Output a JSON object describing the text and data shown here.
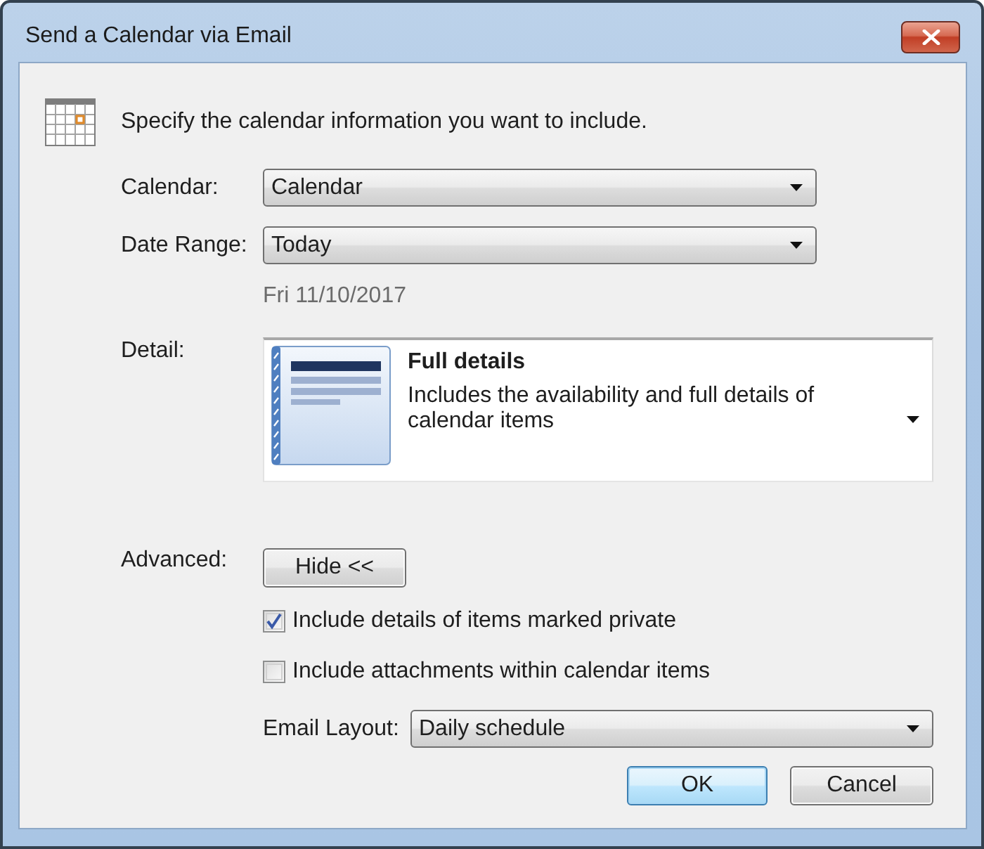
{
  "window": {
    "title": "Send a Calendar via Email"
  },
  "instruction": "Specify the calendar information you want to include.",
  "fields": [
    {
      "label": "Calendar:",
      "value": "Calendar"
    },
    {
      "label": "Date Range:",
      "value": "Today",
      "note": "Fri 11/10/2017"
    }
  ],
  "detail": {
    "label": "Detail:",
    "title": "Full details",
    "description": "Includes the availability and full details of calendar items"
  },
  "advanced": {
    "label": "Advanced:",
    "toggle_button": "Hide <<",
    "options": [
      {
        "label": "Include details of items marked private",
        "checked": true
      },
      {
        "label": "Include attachments within calendar items",
        "checked": false
      }
    ],
    "email_layout": {
      "label": "Email Layout:",
      "value": "Daily schedule"
    }
  },
  "buttons": [
    {
      "label": "OK",
      "default": true
    },
    {
      "label": "Cancel",
      "default": false
    }
  ]
}
